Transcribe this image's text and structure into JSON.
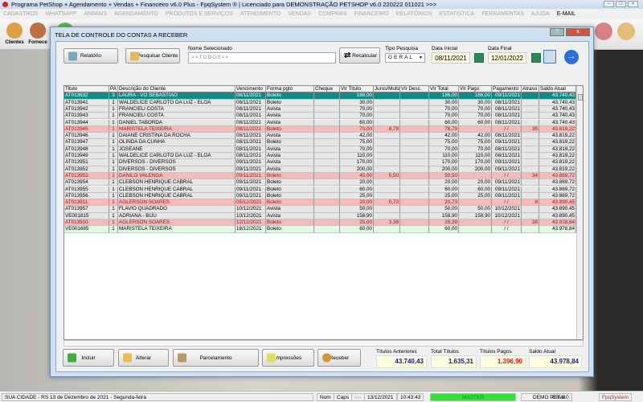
{
  "window": {
    "title": "Programa PetShop + Agendamento + Vendas + Financeiro v6.0 Plus - FpqSystem ® | Licenciado para  DEMONSTRAÇÃO PETSHOP v6.0 220222 011021 >>>"
  },
  "menu": [
    "CADASTROS",
    "WHATSAPP",
    "ANIMAIS",
    "AGENDAMENTO",
    "PRODUTOS E SERVIÇOS",
    "ATENDIMENTO",
    "VENDAS",
    "COMPRAS",
    "FINANCEIRO",
    "RELATÓRIOS",
    "ESTATISTICA",
    "FERRAMENTAS",
    "AJUDA",
    "E-MAIL"
  ],
  "toolbar": {
    "clientes": "Clientes",
    "fornece": "Fornece"
  },
  "dialog": {
    "title": "TELA DE CONTROLE DO CONTAS A RECEBER",
    "relatorio": "Relatório",
    "pesquisar": "Pesquisar Cliente",
    "nome_label": "Nome Selecionado",
    "nome_value": ">>TODOS<<",
    "recalcular": "Recalcular",
    "tipo_label": "Tipo  Pesquisa",
    "tipo_value": "GERAL",
    "data_inicial_label": "Data Inicial",
    "data_inicial": "08/11/2021",
    "data_final_label": "Data Final",
    "data_final": "12/01/2022"
  },
  "grid": {
    "columns": [
      "Titulo",
      "PA",
      "Descrição do Cliente",
      "Vencimento",
      "Forma pgto",
      "Cheque",
      "Vlr Título",
      "Juros/Multa",
      "Vlr Desc.",
      "Vlr Total",
      "Vlr Pago",
      "Pagamento",
      "Atraso",
      "Saldo Atual"
    ],
    "rows": [
      {
        "s": "sel",
        "c": [
          "AT013632",
          "3",
          "LAURA - VÓ SEBASTIÃO",
          "08/11/2021",
          "Boleto",
          "",
          "186,00",
          "",
          "",
          "186,00",
          "186,00",
          "09/11/2021",
          "",
          "43.740,43"
        ]
      },
      {
        "s": "",
        "c": [
          "AT013941",
          "1",
          "WALDELICE CARLOTO DA LUZ - ELOÁ",
          "08/11/2021",
          "Boleto",
          "",
          "30,00",
          "",
          "",
          "30,00",
          "30,00",
          "08/11/2021",
          "",
          "43.740,43"
        ]
      },
      {
        "s": "",
        "c": [
          "AT013942",
          "1",
          "FRANCIELI COSTA",
          "08/11/2021",
          "Avista",
          "",
          "70,00",
          "",
          "",
          "70,00",
          "70,00",
          "08/11/2021",
          "",
          "43.740,43"
        ]
      },
      {
        "s": "",
        "c": [
          "AT013943",
          "1",
          "FRANCIELI COSTA",
          "08/11/2021",
          "Avista",
          "",
          "70,00",
          "",
          "",
          "70,00",
          "70,00",
          "08/11/2021",
          "",
          "43.740,43"
        ]
      },
      {
        "s": "",
        "c": [
          "AT013944",
          "1",
          "DANIEL TABORDA",
          "08/11/2021",
          "Avista",
          "",
          "60,00",
          "",
          "",
          "60,00",
          "60,00",
          "08/11/2021",
          "",
          "43.740,43"
        ]
      },
      {
        "s": "late",
        "c": [
          "AT013945",
          "1",
          "MARISTELA TEIXEIRA",
          "08/11/2021",
          "Boleto",
          "",
          "70,00",
          "8,79",
          "",
          "78,79",
          "",
          "/ /",
          "35",
          "43.819,22"
        ]
      },
      {
        "s": "",
        "c": [
          "AT013946",
          "1",
          "DAIANE CRISTINA DA ROCHA",
          "08/11/2021",
          "Avista",
          "",
          "42,00",
          "",
          "",
          "42,00",
          "42,00",
          "08/11/2021",
          "",
          "43.819,22"
        ]
      },
      {
        "s": "",
        "c": [
          "AT013947",
          "1",
          "OLINDA DA CUNHA",
          "08/11/2021",
          "Boleto",
          "",
          "75,00",
          "",
          "",
          "75,00",
          "75,00",
          "09/11/2021",
          "",
          "43.819,22"
        ]
      },
      {
        "s": "",
        "c": [
          "AT013948",
          "1",
          "JOSEANE",
          "08/11/2021",
          "Avista",
          "",
          "70,00",
          "",
          "",
          "70,00",
          "70,00",
          "08/11/2021",
          "",
          "43.819,22"
        ]
      },
      {
        "s": "",
        "c": [
          "AT013949",
          "1",
          "WALDELICE CARLOTO DA LUZ - ELOÁ",
          "08/11/2021",
          "Avista",
          "",
          "110,00",
          "",
          "",
          "110,00",
          "110,00",
          "08/11/2021",
          "",
          "43.819,22"
        ]
      },
      {
        "s": "",
        "c": [
          "AT013951",
          "1",
          "DIVERSOS - DIVERSOS",
          "09/11/2021",
          "Avista",
          "",
          "170,00",
          "",
          "",
          "170,00",
          "170,00",
          "09/11/2021",
          "",
          "43.819,22"
        ]
      },
      {
        "s": "",
        "c": [
          "AT013952",
          "1",
          "DIVERSOS - DIVERSOS",
          "09/11/2021",
          "Avista",
          "",
          "200,00",
          "",
          "",
          "200,00",
          "200,00",
          "09/11/2021",
          "",
          "43.819,22"
        ]
      },
      {
        "s": "late",
        "c": [
          "AT013953",
          "1",
          "DANILO VALENGA",
          "09/11/2021",
          "Boleto",
          "",
          "45,00",
          "5,50",
          "",
          "50,50",
          "",
          "/ /",
          "34",
          "43.869,72"
        ]
      },
      {
        "s": "",
        "c": [
          "AT013954",
          "1",
          "CLEBSON HENRIQUE CABRAL",
          "09/11/2021",
          "Boleto",
          "",
          "20,00",
          "",
          "",
          "20,00",
          "20,00",
          "09/11/2021",
          "",
          "43.869,72"
        ]
      },
      {
        "s": "",
        "c": [
          "AT013955",
          "1",
          "CLEBSON HENRIQUE CABRAL",
          "09/11/2021",
          "Boleto",
          "",
          "60,00",
          "",
          "",
          "60,00",
          "60,00",
          "09/11/2021",
          "",
          "43.869,72"
        ]
      },
      {
        "s": "",
        "c": [
          "AT013956",
          "1",
          "CLEBSON HENRIQUE CABRAL",
          "09/11/2021",
          "Boleto",
          "",
          "25,00",
          "",
          "",
          "25,00",
          "25,00",
          "09/11/2021",
          "",
          "43.869,72"
        ]
      },
      {
        "s": "late",
        "c": [
          "AT013911",
          "1",
          "AGLERSON SOARES",
          "05/12/2021",
          "Boleto",
          "",
          "20,00",
          "0,73",
          "",
          "20,73",
          "",
          "/ /",
          "8",
          "43.890,45"
        ]
      },
      {
        "s": "",
        "c": [
          "AT013957",
          "1",
          "FLAVIO QUADRADO",
          "10/12/2021",
          "Avista",
          "",
          "50,00",
          "",
          "",
          "50,00",
          "50,00",
          "10/12/2021",
          "",
          "43.890,45"
        ]
      },
      {
        "s": "",
        "c": [
          "VE001815",
          "1",
          "ADRIANA - BIJU",
          "10/12/2021",
          "Avista",
          "",
          "158,90",
          "",
          "",
          "158,90",
          "158,90",
          "10/12/2021",
          "",
          "43.890,45"
        ]
      },
      {
        "s": "late",
        "c": [
          "AT013910",
          "1",
          "AGLERSON SOARES",
          "12/12/2021",
          "Boleto",
          "",
          "25,00",
          "3,39",
          "",
          "28,39",
          "",
          "/ /",
          "38",
          "43.918,84"
        ]
      },
      {
        "s": "open",
        "c": [
          "VE001685",
          "1",
          "MARISTELA TEIXEIRA",
          "18/12/2021",
          "Boleto",
          "",
          "60,00",
          "",
          "",
          "60,00",
          "",
          "/ /",
          "",
          "43.978,84"
        ]
      }
    ]
  },
  "actions": {
    "incluir": "Incluir",
    "alterar": "Alterar",
    "parcelamento": "Parcelamento",
    "impressoes": "Impressões",
    "receber": "Receber"
  },
  "totals": {
    "anteriores_label": "Títulos Anteriores",
    "anteriores": "43.740,43",
    "total_label": "Total Títulos",
    "total": "1.635,31",
    "pagos_label": "Títulos Pagos",
    "pagos": "1.396,90",
    "saldo_label": "Saldo Atual",
    "saldo": "43.978,84"
  },
  "status": {
    "city": "SUA CIDADE - RS 13 de Dezembro de 2021 - Segunda-feira",
    "num": "Num",
    "caps": "Caps",
    "ins": "Ins",
    "date": "13/12/2021",
    "time": "10:43:43",
    "user": "MASTER",
    "version": "DEMO PET 6.0",
    "email": "Email",
    "brand": "FpqSystem"
  },
  "colors": {
    "selected": "#0f8a84",
    "late": "#f7b9b9",
    "open": "#e2f9e2",
    "red": "#e01010",
    "navy": "#1a1a7a"
  }
}
